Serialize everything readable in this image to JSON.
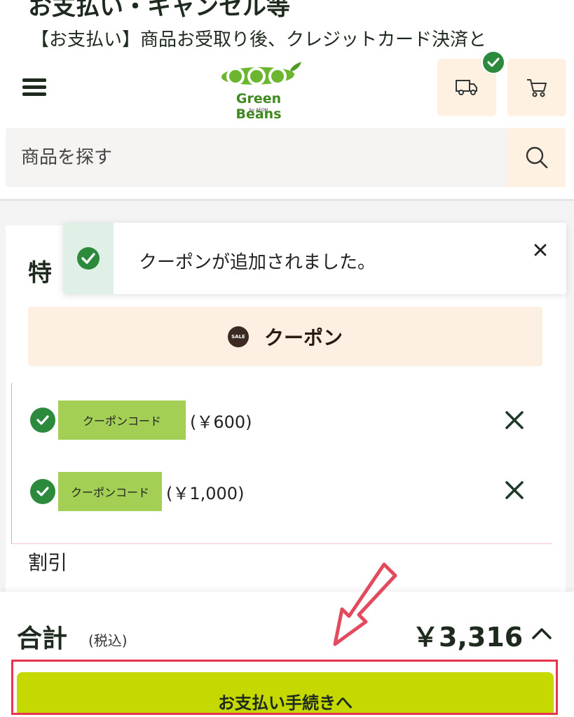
{
  "background": {
    "heading": "お支払い・キャンセル等",
    "text": "【お支払い】商品お受取り後、クレジットカード決済と"
  },
  "header": {
    "logo_text": "Green Beans",
    "logo_sub": "by AEON"
  },
  "search": {
    "placeholder": "商品を探す"
  },
  "section": {
    "title_partial": "特"
  },
  "coupon_bar": {
    "badge": "SALE",
    "label": "クーポン"
  },
  "coupons": [
    {
      "code": "クーポンコード",
      "amount": "(￥600)"
    },
    {
      "code": "クーポンコード",
      "amount": "(￥1,000)"
    }
  ],
  "discount_label": "割引",
  "toast": {
    "message": "クーポンが追加されました。"
  },
  "footer": {
    "total_label": "合計",
    "tax_note": "(税込)",
    "total_amount": "￥3,316",
    "pay_button": "お支払い手続きへ"
  },
  "colors": {
    "brand_green": "#3f8a1f",
    "check_green": "#2c8a3d",
    "chip_green": "#a3cf55",
    "pay_button": "#c5d900",
    "highlight_red": "#e8344d",
    "accent_cream": "#fff1e2"
  }
}
